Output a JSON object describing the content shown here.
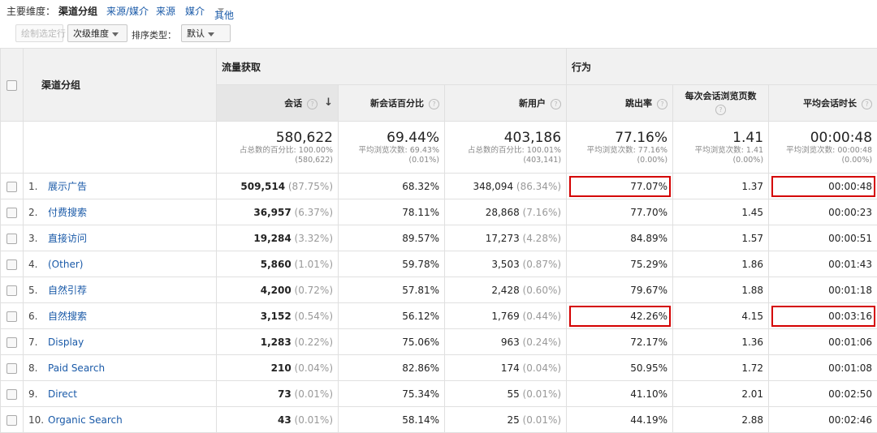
{
  "dimension_bar": {
    "label": "主要维度：",
    "active": "渠道分组",
    "links": [
      "来源/媒介",
      "来源",
      "媒介",
      "其他"
    ]
  },
  "toolbar": {
    "plot_rows": "绘制选定行",
    "secondary_dimension": "次级维度",
    "sort_type_label": "排序类型：",
    "sort_type_value": "默认"
  },
  "table": {
    "channel_header": "渠道分组",
    "groups": [
      "流量获取",
      "行为"
    ],
    "columns": [
      "会话",
      "新会话百分比",
      "新用户",
      "跳出率",
      "每次会话浏览页数",
      "平均会话时长"
    ],
    "summary": [
      {
        "value": "580,622",
        "sub1": "占总数的百分比: 100.00%",
        "sub2": "(580,622)"
      },
      {
        "value": "69.44%",
        "sub1": "平均浏览次数: 69.43%",
        "sub2": "(0.01%)"
      },
      {
        "value": "403,186",
        "sub1": "占总数的百分比: 100.01%",
        "sub2": "(403,141)"
      },
      {
        "value": "77.16%",
        "sub1": "平均浏览次数: 77.16%",
        "sub2": "(0.00%)"
      },
      {
        "value": "1.41",
        "sub1": "平均浏览次数: 1.41",
        "sub2": "(0.00%)"
      },
      {
        "value": "00:00:48",
        "sub1": "平均浏览次数: 00:00:48",
        "sub2": "(0.00%)"
      }
    ],
    "rows": [
      {
        "idx": "1.",
        "name": "展示广告",
        "sessions": "509,514",
        "sessions_pct": "(87.75%)",
        "new_pct": "68.32%",
        "new_users": "348,094",
        "new_users_pct": "(86.34%)",
        "bounce": "77.07%",
        "pages": "1.37",
        "duration": "00:00:48"
      },
      {
        "idx": "2.",
        "name": "付费搜索",
        "sessions": "36,957",
        "sessions_pct": "(6.37%)",
        "new_pct": "78.11%",
        "new_users": "28,868",
        "new_users_pct": "(7.16%)",
        "bounce": "77.70%",
        "pages": "1.45",
        "duration": "00:00:23"
      },
      {
        "idx": "3.",
        "name": "直接访问",
        "sessions": "19,284",
        "sessions_pct": "(3.32%)",
        "new_pct": "89.57%",
        "new_users": "17,273",
        "new_users_pct": "(4.28%)",
        "bounce": "84.89%",
        "pages": "1.57",
        "duration": "00:00:51"
      },
      {
        "idx": "4.",
        "name": "(Other)",
        "sessions": "5,860",
        "sessions_pct": "(1.01%)",
        "new_pct": "59.78%",
        "new_users": "3,503",
        "new_users_pct": "(0.87%)",
        "bounce": "75.29%",
        "pages": "1.86",
        "duration": "00:01:43"
      },
      {
        "idx": "5.",
        "name": "自然引荐",
        "sessions": "4,200",
        "sessions_pct": "(0.72%)",
        "new_pct": "57.81%",
        "new_users": "2,428",
        "new_users_pct": "(0.60%)",
        "bounce": "79.67%",
        "pages": "1.88",
        "duration": "00:01:18"
      },
      {
        "idx": "6.",
        "name": "自然搜索",
        "sessions": "3,152",
        "sessions_pct": "(0.54%)",
        "new_pct": "56.12%",
        "new_users": "1,769",
        "new_users_pct": "(0.44%)",
        "bounce": "42.26%",
        "pages": "4.15",
        "duration": "00:03:16"
      },
      {
        "idx": "7.",
        "name": "Display",
        "sessions": "1,283",
        "sessions_pct": "(0.22%)",
        "new_pct": "75.06%",
        "new_users": "963",
        "new_users_pct": "(0.24%)",
        "bounce": "72.17%",
        "pages": "1.36",
        "duration": "00:01:06"
      },
      {
        "idx": "8.",
        "name": "Paid Search",
        "sessions": "210",
        "sessions_pct": "(0.04%)",
        "new_pct": "82.86%",
        "new_users": "174",
        "new_users_pct": "(0.04%)",
        "bounce": "50.95%",
        "pages": "1.72",
        "duration": "00:01:08"
      },
      {
        "idx": "9.",
        "name": "Direct",
        "sessions": "73",
        "sessions_pct": "(0.01%)",
        "new_pct": "75.34%",
        "new_users": "55",
        "new_users_pct": "(0.01%)",
        "bounce": "41.10%",
        "pages": "2.01",
        "duration": "00:02:50"
      },
      {
        "idx": "10.",
        "name": "Organic Search",
        "sessions": "43",
        "sessions_pct": "(0.01%)",
        "new_pct": "58.14%",
        "new_users": "25",
        "new_users_pct": "(0.01%)",
        "bounce": "44.19%",
        "pages": "2.88",
        "duration": "00:02:46"
      }
    ]
  },
  "icons": {
    "help": "help-icon",
    "sort_arrow": "arrow-down-icon",
    "caret": "chevron-down-icon",
    "checkbox": "checkbox-icon"
  },
  "colors": {
    "link": "#1a5aa8",
    "highlight": "#d40000",
    "header_bg": "#f1f1f1"
  }
}
